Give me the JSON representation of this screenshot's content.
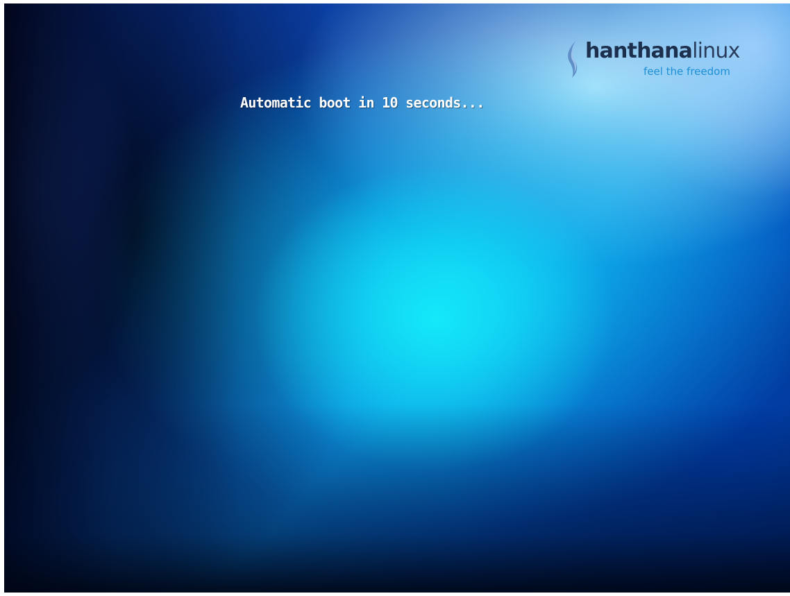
{
  "boot": {
    "message": "Automatic boot in 10 seconds...",
    "countdown_seconds": 10
  },
  "logo": {
    "brand_bold": "hanthana",
    "brand_light": "linux",
    "tagline": "feel the freedom",
    "mark_icon": "hanthana-flame-icon"
  },
  "colors": {
    "message_text": "#ffffff",
    "brand_dark": "#1c2f4c",
    "tagline_blue": "#1d8fd4",
    "background_center": "#14ebfa",
    "background_edge": "#000814"
  }
}
